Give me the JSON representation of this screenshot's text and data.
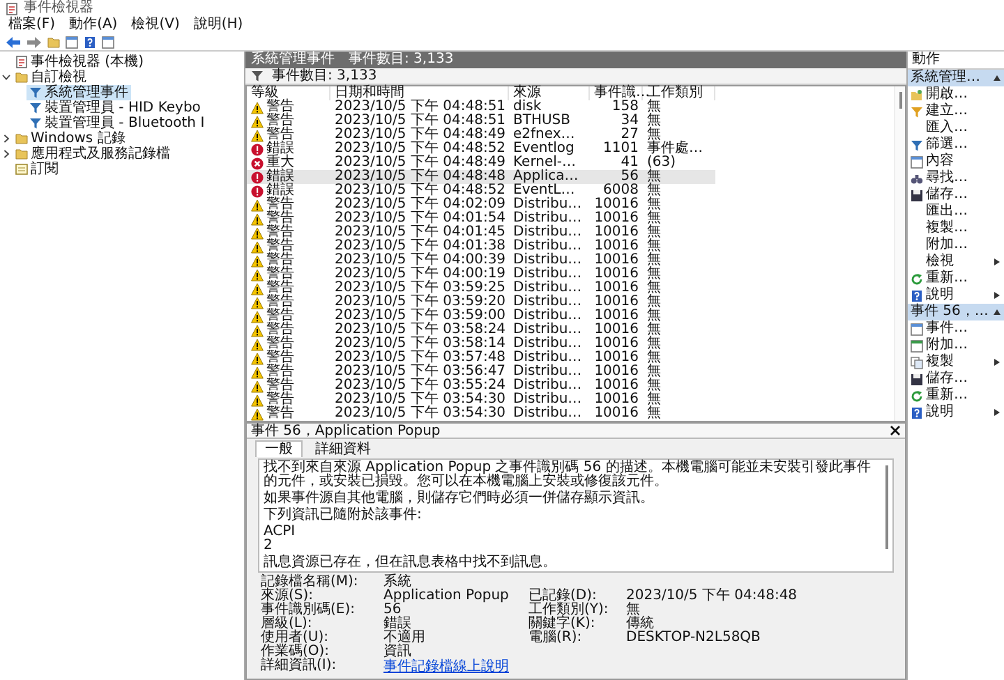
{
  "window": {
    "title": "事件檢視器"
  },
  "menu": [
    "檔案(F)",
    "動作(A)",
    "檢視(V)",
    "說明(H)"
  ],
  "tree": [
    {
      "label": "事件檢視器 (本機)",
      "kind": "viewer",
      "selected": false,
      "children": [
        {
          "label": "自訂檢視",
          "kind": "folder",
          "selected": false,
          "expanded": true,
          "children": [
            {
              "label": "系統管理事件",
              "kind": "filter",
              "selected": true
            },
            {
              "label": "裝置管理員 - HID Keybo",
              "kind": "filter",
              "selected": false
            },
            {
              "label": "裝置管理員 - Bluetooth I",
              "kind": "filter",
              "selected": false
            }
          ]
        },
        {
          "label": "Windows 記錄",
          "kind": "folder",
          "selected": false,
          "expanded": false
        },
        {
          "label": "應用程式及服務記錄檔",
          "kind": "folder",
          "selected": false,
          "expanded": false
        },
        {
          "label": "訂閱",
          "kind": "subscription",
          "selected": false
        }
      ]
    }
  ],
  "header": {
    "title": "系統管理事件",
    "count": "事件數目: 3,133"
  },
  "filter_bar": {
    "count": "事件數目: 3,133"
  },
  "table": {
    "columns": [
      "等級",
      "日期和時間",
      "來源",
      "事件識…",
      "工作類別"
    ],
    "rows": [
      {
        "kind": "warning",
        "level": "警告",
        "time": "2023/10/5 下午 04:48:51",
        "source": "disk",
        "id": "158",
        "category": "無",
        "selected": false
      },
      {
        "kind": "warning",
        "level": "警告",
        "time": "2023/10/5 下午 04:48:51",
        "source": "BTHUSB",
        "id": "34",
        "category": "無",
        "selected": false
      },
      {
        "kind": "warning",
        "level": "警告",
        "time": "2023/10/5 下午 04:48:49",
        "source": "e2fnex…",
        "id": "27",
        "category": "無",
        "selected": false
      },
      {
        "kind": "error",
        "level": "錯誤",
        "time": "2023/10/5 下午 04:48:52",
        "source": "Eventlog",
        "id": "1101",
        "category": "事件處…",
        "selected": false
      },
      {
        "kind": "critical",
        "level": "重大",
        "time": "2023/10/5 下午 04:48:49",
        "source": "Kernel-…",
        "id": "41",
        "category": "(63)",
        "selected": false
      },
      {
        "kind": "error",
        "level": "錯誤",
        "time": "2023/10/5 下午 04:48:48",
        "source": "Applica…",
        "id": "56",
        "category": "無",
        "selected": true
      },
      {
        "kind": "error",
        "level": "錯誤",
        "time": "2023/10/5 下午 04:48:52",
        "source": "EventL…",
        "id": "6008",
        "category": "無",
        "selected": false
      },
      {
        "kind": "warning",
        "level": "警告",
        "time": "2023/10/5 下午 04:02:09",
        "source": "Distribu…",
        "id": "10016",
        "category": "無",
        "selected": false
      },
      {
        "kind": "warning",
        "level": "警告",
        "time": "2023/10/5 下午 04:01:54",
        "source": "Distribu…",
        "id": "10016",
        "category": "無",
        "selected": false
      },
      {
        "kind": "warning",
        "level": "警告",
        "time": "2023/10/5 下午 04:01:45",
        "source": "Distribu…",
        "id": "10016",
        "category": "無",
        "selected": false
      },
      {
        "kind": "warning",
        "level": "警告",
        "time": "2023/10/5 下午 04:01:38",
        "source": "Distribu…",
        "id": "10016",
        "category": "無",
        "selected": false
      },
      {
        "kind": "warning",
        "level": "警告",
        "time": "2023/10/5 下午 04:00:39",
        "source": "Distribu…",
        "id": "10016",
        "category": "無",
        "selected": false
      },
      {
        "kind": "warning",
        "level": "警告",
        "time": "2023/10/5 下午 04:00:19",
        "source": "Distribu…",
        "id": "10016",
        "category": "無",
        "selected": false
      },
      {
        "kind": "warning",
        "level": "警告",
        "time": "2023/10/5 下午 03:59:25",
        "source": "Distribu…",
        "id": "10016",
        "category": "無",
        "selected": false
      },
      {
        "kind": "warning",
        "level": "警告",
        "time": "2023/10/5 下午 03:59:20",
        "source": "Distribu…",
        "id": "10016",
        "category": "無",
        "selected": false
      },
      {
        "kind": "warning",
        "level": "警告",
        "time": "2023/10/5 下午 03:59:00",
        "source": "Distribu…",
        "id": "10016",
        "category": "無",
        "selected": false
      },
      {
        "kind": "warning",
        "level": "警告",
        "time": "2023/10/5 下午 03:58:24",
        "source": "Distribu…",
        "id": "10016",
        "category": "無",
        "selected": false
      },
      {
        "kind": "warning",
        "level": "警告",
        "time": "2023/10/5 下午 03:58:14",
        "source": "Distribu…",
        "id": "10016",
        "category": "無",
        "selected": false
      },
      {
        "kind": "warning",
        "level": "警告",
        "time": "2023/10/5 下午 03:57:48",
        "source": "Distribu…",
        "id": "10016",
        "category": "無",
        "selected": false
      },
      {
        "kind": "warning",
        "level": "警告",
        "time": "2023/10/5 下午 03:56:47",
        "source": "Distribu…",
        "id": "10016",
        "category": "無",
        "selected": false
      },
      {
        "kind": "warning",
        "level": "警告",
        "time": "2023/10/5 下午 03:55:24",
        "source": "Distribu…",
        "id": "10016",
        "category": "無",
        "selected": false
      },
      {
        "kind": "warning",
        "level": "警告",
        "time": "2023/10/5 下午 03:54:30",
        "source": "Distribu…",
        "id": "10016",
        "category": "無",
        "selected": false
      },
      {
        "kind": "warning",
        "level": "警告",
        "time": "2023/10/5 下午 03:54:30",
        "source": "Distribu…",
        "id": "10016",
        "category": "無",
        "selected": false
      }
    ]
  },
  "detail": {
    "title": "事件 56，Application Popup",
    "tabs": [
      {
        "label": "一般",
        "selected": true
      },
      {
        "label": "詳細資料",
        "selected": false
      }
    ],
    "description": [
      [
        "找不到來自來源 Application Popup 之事件識別碼 56 的描述。本機電腦可能並未安裝引發此事件的元件，或安裝已損毀。您可以在本機電腦上安裝或修復該元件。"
      ],
      [
        "如果事件源自其他電腦，則儲存它們時必須一併儲存顯示資訊。"
      ],
      [
        "下列資訊已隨附於該事件:"
      ],
      [
        "ACPI",
        "2"
      ],
      [
        "訊息資源已存在，但在訊息表格中找不到訊息。"
      ]
    ],
    "rows": [
      {
        "cells": [
          {
            "kind": "text",
            "label": "記錄檔名稱(M):",
            "value": "系統"
          }
        ]
      },
      {
        "cells": [
          {
            "kind": "text",
            "label": "來源(S):",
            "value": "Application Popup"
          },
          {
            "kind": "text",
            "label": "已記錄(D):",
            "value": "2023/10/5 下午 04:48:48"
          }
        ]
      },
      {
        "cells": [
          {
            "kind": "text",
            "label": "事件識別碼(E):",
            "value": "56"
          },
          {
            "kind": "text",
            "label": "工作類別(Y):",
            "value": "無"
          }
        ]
      },
      {
        "cells": [
          {
            "kind": "text",
            "label": "層級(L):",
            "value": "錯誤"
          },
          {
            "kind": "text",
            "label": "關鍵字(K):",
            "value": "傳統"
          }
        ]
      },
      {
        "cells": [
          {
            "kind": "text",
            "label": "使用者(U):",
            "value": "不適用"
          },
          {
            "kind": "text",
            "label": "電腦(R):",
            "value": "DESKTOP-N2L58QB"
          }
        ]
      },
      {
        "cells": [
          {
            "kind": "text",
            "label": "作業碼(O):",
            "value": "資訊"
          }
        ]
      },
      {
        "cells": [
          {
            "kind": "link",
            "label": "詳細資訊(I):",
            "value": "事件記錄檔線上說明"
          }
        ]
      }
    ]
  },
  "actions": {
    "title": "動作",
    "sections": [
      {
        "title": "系統管理…",
        "expanded": true,
        "items": [
          {
            "label": "開啟…",
            "kind": "open",
            "submenu": false
          },
          {
            "label": "建立…",
            "kind": "create",
            "submenu": false
          },
          {
            "label": "匯入…",
            "kind": "plain",
            "submenu": false
          },
          {
            "label": "篩選…",
            "kind": "filter",
            "submenu": false
          },
          {
            "label": "內容",
            "kind": "properties",
            "submenu": false
          },
          {
            "label": "尋找…",
            "kind": "find",
            "submenu": false
          },
          {
            "label": "儲存…",
            "kind": "save",
            "submenu": false
          },
          {
            "label": "匯出…",
            "kind": "plain",
            "submenu": false
          },
          {
            "label": "複製…",
            "kind": "plain",
            "submenu": false
          },
          {
            "label": "附加…",
            "kind": "plain",
            "submenu": false
          },
          {
            "label": "檢視",
            "kind": "plain",
            "submenu": true
          },
          {
            "label": "重新…",
            "kind": "refresh",
            "submenu": false
          },
          {
            "label": "說明",
            "kind": "help",
            "submenu": true
          }
        ]
      },
      {
        "title": "事件 56，…",
        "expanded": true,
        "items": [
          {
            "label": "事件…",
            "kind": "properties",
            "submenu": false
          },
          {
            "label": "附加…",
            "kind": "attach",
            "submenu": false
          },
          {
            "label": "複製",
            "kind": "copy",
            "submenu": true
          },
          {
            "label": "儲存…",
            "kind": "save",
            "submenu": false
          },
          {
            "label": "重新…",
            "kind": "refresh",
            "submenu": false
          },
          {
            "label": "說明",
            "kind": "help",
            "submenu": true
          }
        ]
      }
    ]
  }
}
